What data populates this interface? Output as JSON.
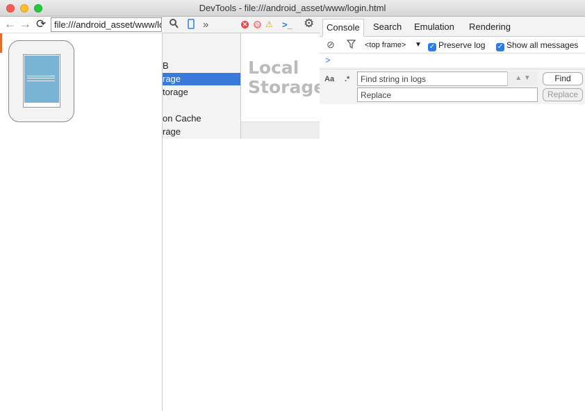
{
  "window": {
    "title": "DevTools - file:///android_asset/www/login.html"
  },
  "browser": {
    "url": "file:///android_asset/www/login.html",
    "back_icon": "arrow-left-icon",
    "forward_icon": "arrow-right-icon",
    "reload_icon": "reload-icon"
  },
  "resources": {
    "items": [
      {
        "label": "B"
      },
      {
        "label": "rage"
      },
      {
        "label": "torage"
      },
      {
        "label": ""
      },
      {
        "label": "on Cache"
      },
      {
        "label": "rage"
      }
    ]
  },
  "storage": {
    "title_line1": "Local",
    "title_line2": "Storage"
  },
  "devtools_toolbar": {
    "overflow": "»"
  },
  "drawer": {
    "tabs": [
      {
        "label": "Console"
      },
      {
        "label": "Search"
      },
      {
        "label": "Emulation"
      },
      {
        "label": "Rendering"
      }
    ],
    "frame_select": "<top frame>",
    "preserve_log": "Preserve log",
    "show_all": "Show all messages",
    "prompt": ">",
    "match_case": "Aa",
    "regex": ".*",
    "find_placeholder": "Find string in logs",
    "replace_placeholder": "Replace",
    "find_button": "Find",
    "replace_button": "Replace"
  },
  "colors": {
    "selection": "#3879d9",
    "checkbox": "#2b7de9",
    "device_screen": "#7ab4d4"
  }
}
